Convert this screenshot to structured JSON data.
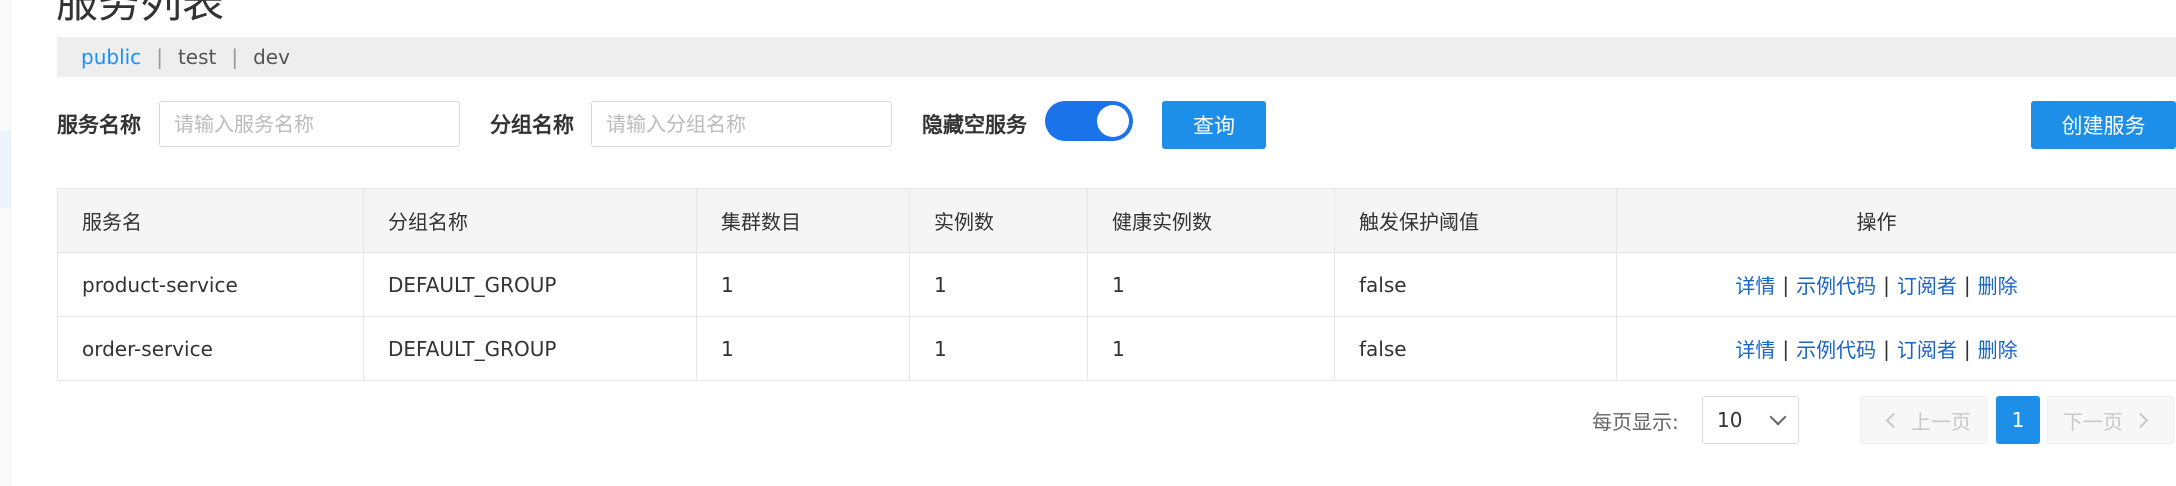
{
  "page_title": "服务列表",
  "namespaces": [
    {
      "label": "public",
      "active": true
    },
    {
      "label": "test",
      "active": false
    },
    {
      "label": "dev",
      "active": false
    }
  ],
  "namespace_separator": "|",
  "filters": {
    "service_name_label": "服务名称",
    "service_name_placeholder": "请输入服务名称",
    "group_name_label": "分组名称",
    "group_name_placeholder": "请输入分组名称",
    "hide_empty_label": "隐藏空服务",
    "hide_empty_on": true,
    "query_button": "查询",
    "create_button": "创建服务"
  },
  "table": {
    "columns": [
      "服务名",
      "分组名称",
      "集群数目",
      "实例数",
      "健康实例数",
      "触发保护阈值",
      "操作"
    ],
    "rows": [
      [
        "product-service",
        "DEFAULT_GROUP",
        "1",
        "1",
        "1",
        "false"
      ],
      [
        "order-service",
        "DEFAULT_GROUP",
        "1",
        "1",
        "1",
        "false"
      ]
    ],
    "operations": [
      "详情",
      "示例代码",
      "订阅者",
      "删除"
    ],
    "op_separator": "|"
  },
  "pagination": {
    "page_size_label": "每页显示:",
    "page_size": "10",
    "prev_label": "上一页",
    "current_page": "1",
    "next_label": "下一页"
  },
  "colors": {
    "primary": "#1e8fe8",
    "link": "#1865c9",
    "active_namespace": "#1890ff",
    "toggle_on": "#1a73e8"
  },
  "icons": {
    "page_size_dropdown": "chevron-down-icon",
    "prev": "chevron-left-icon",
    "next": "chevron-right-icon"
  }
}
